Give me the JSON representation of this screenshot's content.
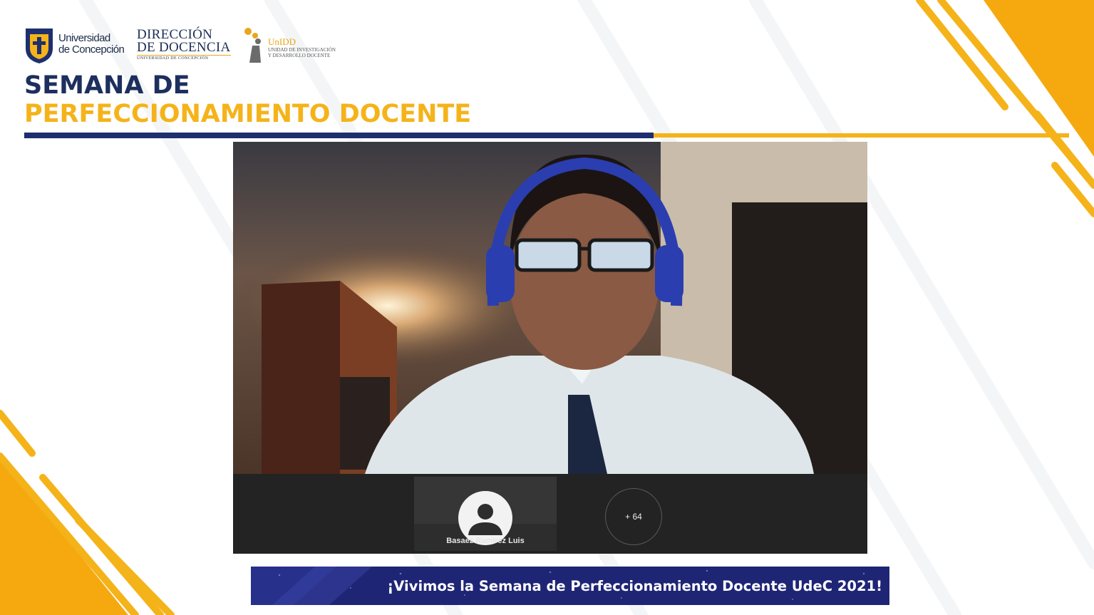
{
  "colors": {
    "navy": "#1d2f6e",
    "gold": "#f5b31a",
    "banner_blue": "#1f2575",
    "zoom_strip": "#232323"
  },
  "header": {
    "university_line1": "Universidad",
    "university_line2": "de Concepción",
    "dd_title_line1": "DIRECCIÓN",
    "dd_title_line2": "DE DOCENCIA",
    "dd_subtitle": "UNIVERSIDAD DE CONCEPCIÓN",
    "unidd_name": "UnIDD",
    "unidd_line1": "UNIDAD DE INVESTIGACIÓN",
    "unidd_line2": "Y DESARROLLO DOCENTE"
  },
  "event": {
    "title_line1": "SEMANA DE",
    "title_line2": "PERFECCIONAMIENTO DOCENTE"
  },
  "meeting": {
    "speaker_view": "video-feed",
    "participant_name": "Basaez Ramirez Luis",
    "more_participants": "+ 64",
    "avatar_icon": "user-silhouette-icon"
  },
  "banner": {
    "text": "¡Vivimos la Semana de Perfeccionamiento Docente UdeC 2021!"
  }
}
